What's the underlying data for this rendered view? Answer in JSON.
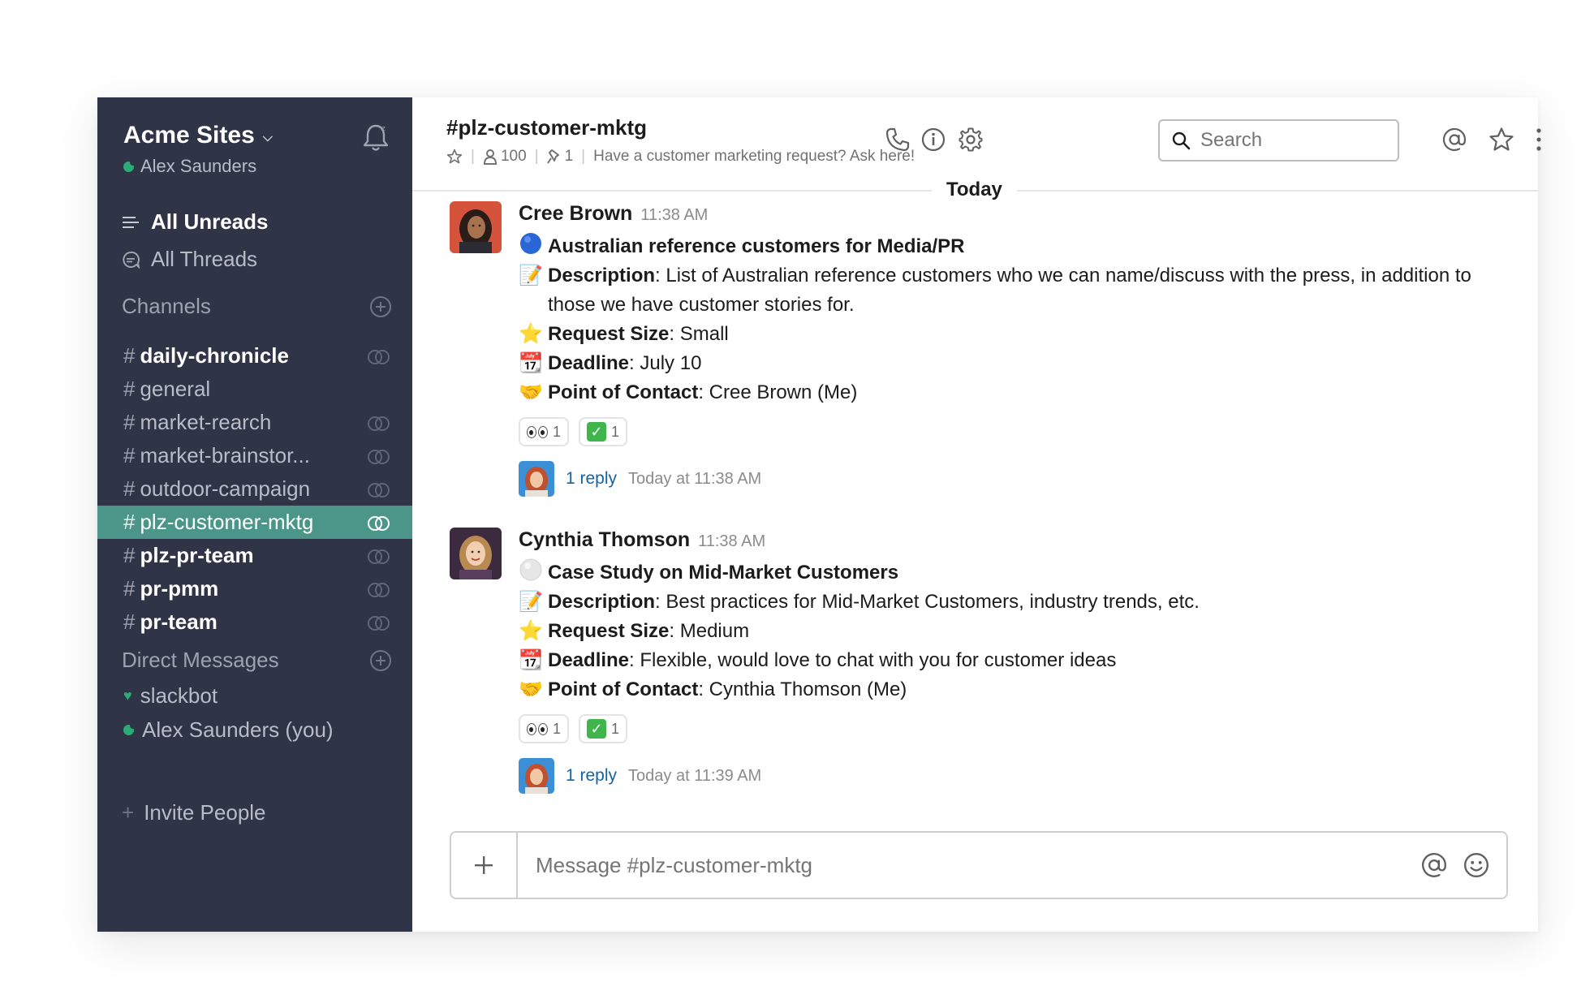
{
  "sidebar": {
    "team_name": "Acme Sites",
    "user_name": "Alex Saunders",
    "all_unreads": "All Unreads",
    "all_threads": "All Threads",
    "channels_header": "Channels",
    "channels": [
      {
        "name": "daily-chronicle",
        "bold": true,
        "shared": true,
        "active": false
      },
      {
        "name": "general",
        "bold": false,
        "shared": false,
        "active": false
      },
      {
        "name": "market-rearch",
        "bold": false,
        "shared": true,
        "active": false
      },
      {
        "name": "market-brainstor...",
        "bold": false,
        "shared": true,
        "active": false
      },
      {
        "name": "outdoor-campaign",
        "bold": false,
        "shared": true,
        "active": false
      },
      {
        "name": "plz-customer-mktg",
        "bold": false,
        "shared": true,
        "active": true
      },
      {
        "name": "plz-pr-team",
        "bold": true,
        "shared": true,
        "active": false
      },
      {
        "name": "pr-pmm",
        "bold": true,
        "shared": true,
        "active": false
      },
      {
        "name": "pr-team",
        "bold": true,
        "shared": true,
        "active": false
      }
    ],
    "dm_header": "Direct Messages",
    "dms": [
      "slackbot",
      "Alex Saunders (you)"
    ],
    "invite": "Invite People"
  },
  "header": {
    "channel_title": "#plz-customer-mktg",
    "member_count": "100",
    "pinned_count": "1",
    "topic": "Have a customer marketing request? Ask here!",
    "search_placeholder": "Search"
  },
  "divider": "Today",
  "messages": [
    {
      "sender": "Cree Brown",
      "time": "11:38 AM",
      "title": "Australian reference customers for Media/PR",
      "description_label": "Description",
      "description": ": List of Australian reference customers who we can name/discuss with the press, in addition to those we have customer stories for.",
      "size_label": "Request Size",
      "size": ": Small",
      "deadline_label": "Deadline",
      "deadline": ": July 10",
      "contact_label": "Point of Contact",
      "contact": ": Cree Brown (Me)",
      "reaction_eyes": "1",
      "reaction_check": "1",
      "reply_count": "1 reply",
      "reply_time": "Today at 11:38 AM"
    },
    {
      "sender": "Cynthia Thomson",
      "time": "11:38 AM",
      "title": "Case Study on Mid-Market Customers",
      "description_label": "Description",
      "description": ": Best practices for Mid-Market Customers, industry trends, etc.",
      "size_label": "Request Size",
      "size": ": Medium",
      "deadline_label": "Deadline",
      "deadline": ": Flexible, would love to chat with you for customer ideas",
      "contact_label": "Point of Contact",
      "contact": ": Cynthia Thomson (Me)",
      "reaction_eyes": "1",
      "reaction_check": "1",
      "reply_count": "1 reply",
      "reply_time": "Today at 11:39 AM"
    }
  ],
  "composer": {
    "placeholder": "Message #plz-customer-mktg"
  },
  "colors": {
    "sidebar": "#2f3446",
    "active_channel": "#4c9689",
    "link": "#1264a3",
    "presence": "#2bac76"
  }
}
